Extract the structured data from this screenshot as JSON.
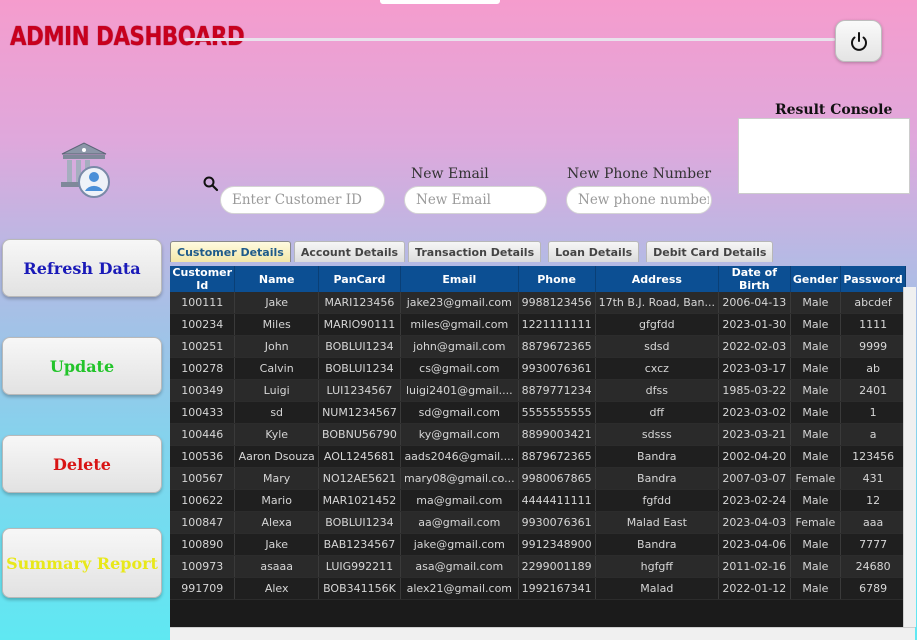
{
  "header": {
    "title": "ADMIN DASHBOARD",
    "logout_icon": "power-icon"
  },
  "console": {
    "label": "Result Console"
  },
  "search": {
    "customer_id_placeholder": "Enter Customer ID",
    "new_email_label": "New Email",
    "new_email_placeholder": "New Email",
    "new_phone_label": "New Phone Number",
    "new_phone_placeholder": "New phone number"
  },
  "sidebar": {
    "refresh": "Refresh Data",
    "update": "Update",
    "delete": "Delete",
    "summary": "Summary Report",
    "colors": {
      "refresh": "#1a1ab8",
      "update": "#22c42a",
      "delete": "#d81414",
      "summary": "#e8e81a"
    }
  },
  "tabs": [
    "Customer Details",
    "Account Details",
    "Transaction Details",
    "Loan Details",
    "Debit Card Details"
  ],
  "table": {
    "columns": [
      "Customer Id",
      "Name",
      "PanCard",
      "Email",
      "Phone",
      "Address",
      "Date of Birth",
      "Gender",
      "Password"
    ],
    "rows": [
      [
        "100111",
        "Jake",
        "MARI123456",
        "jake23@gmail.com",
        "9988123456",
        "17th B.J. Road, Ban...",
        "2006-04-13",
        "Male",
        "abcdef"
      ],
      [
        "100234",
        "Miles",
        "MARIO90111",
        "miles@gmail.com",
        "1221111111",
        "gfgfdd",
        "2023-01-30",
        "Male",
        "1111"
      ],
      [
        "100251",
        "John",
        "BOBLUI1234",
        "john@gmail.com",
        "8879672365",
        "sdsd",
        "2022-02-03",
        "Male",
        "9999"
      ],
      [
        "100278",
        "Calvin",
        "BOBLUI1234",
        "cs@gmail.com",
        "9930076361",
        "cxcz",
        "2023-03-17",
        "Male",
        "ab"
      ],
      [
        "100349",
        "Luigi",
        "LUI1234567",
        "luigi2401@gmail....",
        "8879771234",
        "dfss",
        "1985-03-22",
        "Male",
        "2401"
      ],
      [
        "100433",
        "sd",
        "NUM1234567",
        "sd@gmail.com",
        "5555555555",
        "dff",
        "2023-03-02",
        "Male",
        "1"
      ],
      [
        "100446",
        "Kyle",
        "BOBNU56790",
        "ky@gmail.com",
        "8899003421",
        "sdsss",
        "2023-03-21",
        "Male",
        "a"
      ],
      [
        "100536",
        "Aaron Dsouza",
        "AOL1245681",
        "aads2046@gmail....",
        "8879672365",
        "Bandra",
        "2002-04-20",
        "Male",
        "123456"
      ],
      [
        "100567",
        "Mary",
        "NO12AE5621",
        "mary08@gmail.co...",
        "9980067865",
        "Bandra",
        "2007-03-07",
        "Female",
        "431"
      ],
      [
        "100622",
        "Mario",
        "MAR1021452",
        "ma@gmail.com",
        "4444411111",
        "fgfdd",
        "2023-02-24",
        "Male",
        "12"
      ],
      [
        "100847",
        "Alexa",
        "BOBLUI1234",
        "aa@gmail.com",
        "9930076361",
        "Malad East",
        "2023-04-03",
        "Female",
        "aaa"
      ],
      [
        "100890",
        "Jake",
        "BAB1234567",
        "jake@gmail.com",
        "9912348900",
        "Bandra",
        "2023-04-06",
        "Male",
        "7777"
      ],
      [
        "100973",
        "asaaa",
        "LUIG992211",
        "asa@gmail.com",
        "2299001189",
        "hgfgff",
        "2011-02-16",
        "Male",
        "24680"
      ],
      [
        "991709",
        "Alex",
        "BOB341156K",
        "alex21@gmail.com",
        "1992167341",
        "Malad",
        "2022-01-12",
        "Male",
        "6789"
      ]
    ]
  }
}
